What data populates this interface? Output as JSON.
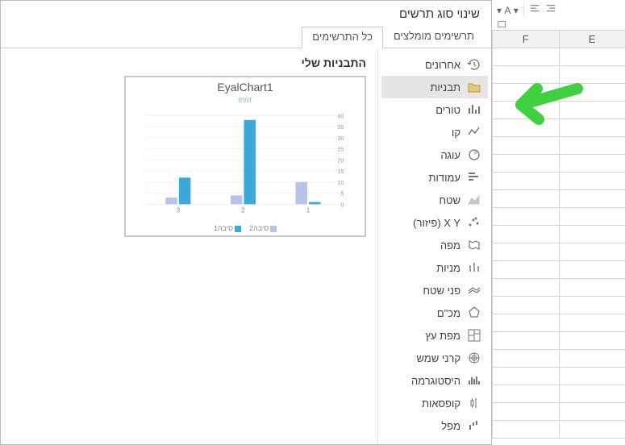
{
  "ribbon": {
    "font_label": "A"
  },
  "sheet": {
    "cols": [
      "F",
      "E"
    ]
  },
  "dialog": {
    "title": "שינוי סוג תרשים",
    "tabs": {
      "recommended": "תרשימים מומלצים",
      "all": "כל התרשימים"
    },
    "categories": [
      {
        "key": "recent",
        "label": "אחרונים",
        "icon": "recent"
      },
      {
        "key": "templates",
        "label": "תבניות",
        "icon": "folder",
        "selected": true
      },
      {
        "key": "column",
        "label": "טורים",
        "icon": "column"
      },
      {
        "key": "line",
        "label": "קו",
        "icon": "line"
      },
      {
        "key": "pie",
        "label": "עוגה",
        "icon": "pie"
      },
      {
        "key": "bar",
        "label": "עמודות",
        "icon": "bar"
      },
      {
        "key": "area",
        "label": "שטח",
        "icon": "area"
      },
      {
        "key": "scatter",
        "label": "X Y (פיזור)",
        "icon": "scatter"
      },
      {
        "key": "map",
        "label": "מפה",
        "icon": "map"
      },
      {
        "key": "stock",
        "label": "מניות",
        "icon": "stock"
      },
      {
        "key": "surface",
        "label": "פני שטח",
        "icon": "surface"
      },
      {
        "key": "radar",
        "label": "מכ\"ם",
        "icon": "radar"
      },
      {
        "key": "treemap",
        "label": "מפת עץ",
        "icon": "treemap"
      },
      {
        "key": "sunburst",
        "label": "קרני שמש",
        "icon": "sunburst"
      },
      {
        "key": "histogram",
        "label": "היסטוגרמה",
        "icon": "histogram"
      },
      {
        "key": "boxwhisker",
        "label": "קופסאות",
        "icon": "boxwhisker"
      },
      {
        "key": "waterfall",
        "label": "מפל",
        "icon": "waterfall"
      }
    ],
    "preview": {
      "heading": "התבניות שלי",
      "chart_name": "EyalChart1",
      "chart_subtitle": "ewr",
      "legend": {
        "s1": "סיבה1",
        "s2": "סיבה2"
      }
    }
  },
  "chart_data": {
    "type": "bar",
    "categories": [
      "1",
      "2",
      "3"
    ],
    "series": [
      {
        "name": "סיבה2",
        "values": [
          10,
          4,
          3
        ],
        "color": "#b8c3ea"
      },
      {
        "name": "סיבה1",
        "values": [
          1,
          38,
          12
        ],
        "color": "#3da9db"
      }
    ],
    "ylim": [
      0,
      40
    ],
    "yticks": [
      0,
      5,
      10,
      15,
      20,
      25,
      30,
      35,
      40
    ],
    "title": "ewr"
  }
}
